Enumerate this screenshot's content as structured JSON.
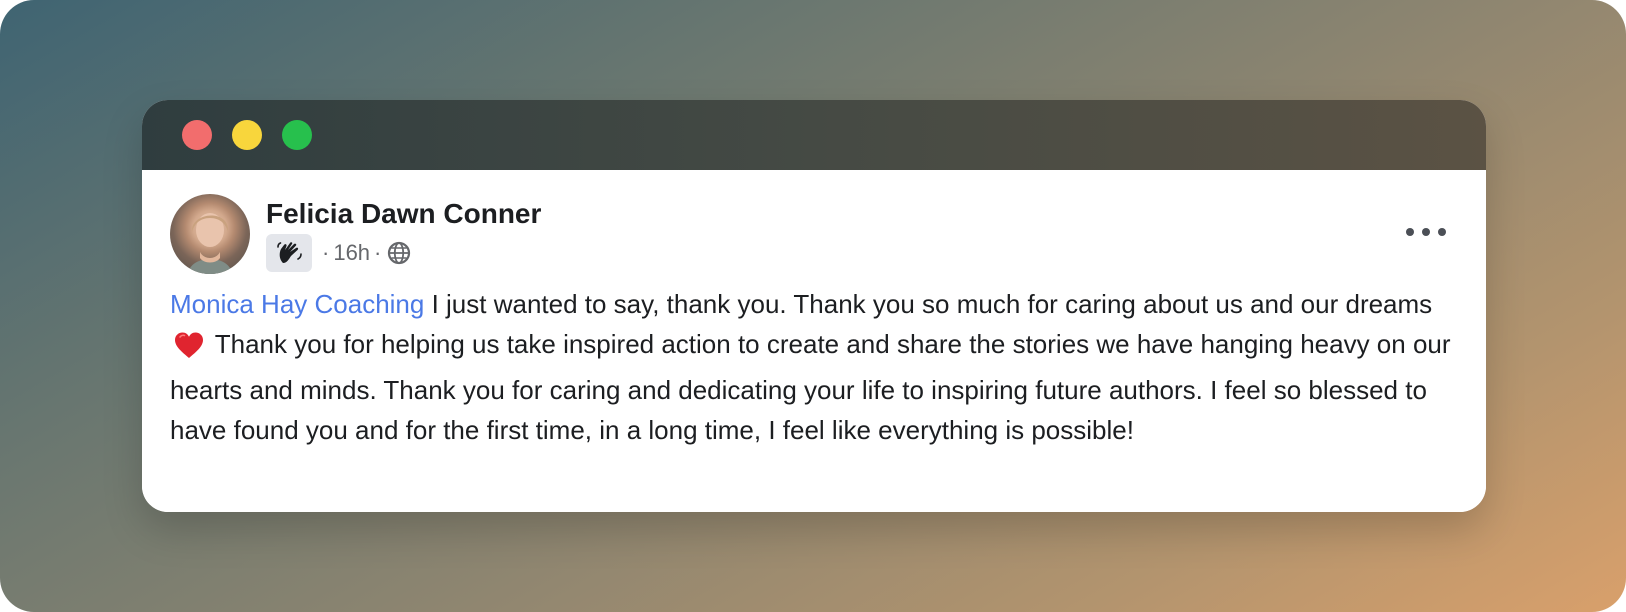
{
  "window": {
    "controls": {
      "close_color": "#f26d6d",
      "minimize_color": "#f8d63c",
      "maximize_color": "#27c04d"
    }
  },
  "post": {
    "author": "Felicia Dawn Conner",
    "badge_icon": "waving-hand-icon",
    "separator": "·",
    "time": "16h",
    "audience_icon": "globe-icon",
    "more_icon": "more-options-icon",
    "mention": "Monica Hay Coaching",
    "text_part1": " I just wanted to say, thank you. Thank you so much for caring about us and our dreams ",
    "heart_icon": "red-heart-icon",
    "text_part2": " Thank you for helping us take inspired action to create and share the stories we have hanging heavy on our hearts and minds. Thank you for caring and dedicating your life to inspiring future authors. I feel so blessed to have found you and for the first time, in a long time, I feel like everything is possible!"
  },
  "colors": {
    "mention": "#4b79e6",
    "heart": "#e0242f",
    "text": "#1c1e21",
    "muted": "#65676b"
  }
}
